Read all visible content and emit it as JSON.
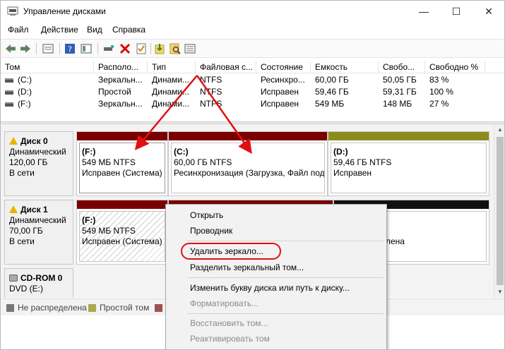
{
  "window": {
    "title": "Управление дисками",
    "minimize_glyph": "—",
    "maximize_glyph": "☐",
    "close_glyph": "✕"
  },
  "menu": [
    "Файл",
    "Действие",
    "Вид",
    "Справка"
  ],
  "toolbar": {
    "icons": [
      "back-icon",
      "forward-icon",
      "properties-icon",
      "help-icon",
      "show-hide-icon",
      "connect-icon",
      "delete-icon",
      "checklist-icon",
      "import-icon",
      "search-icon",
      "list-icon"
    ]
  },
  "volume_table": {
    "columns": [
      "Том",
      "Располо...",
      "Тип",
      "Файловая с...",
      "Состояние",
      "Емкость",
      "Свобо...",
      "Свободно %"
    ],
    "rows": [
      [
        "(C:)",
        "Зеркальн...",
        "Динами...",
        "NTFS",
        "Ресинхро...",
        "60,00 ГБ",
        "50,05 ГБ",
        "83 %"
      ],
      [
        "(D:)",
        "Простой",
        "Динами...",
        "NTFS",
        "Исправен",
        "59,46 ГБ",
        "59,31 ГБ",
        "100 %"
      ],
      [
        "(F:)",
        "Зеркальн...",
        "Динами...",
        "NTFS",
        "Исправен",
        "549 МБ",
        "148 МБ",
        "27 %"
      ]
    ]
  },
  "disks": [
    {
      "name": "Диск 0",
      "type": "Динамический",
      "size": "120,00 ГБ",
      "status": "В сети",
      "partitions": [
        {
          "letter": "(F:)",
          "size": "549 МБ NTFS",
          "state": "Исправен (Система)"
        },
        {
          "letter": "(C:)",
          "size": "60,00 ГБ NTFS",
          "state": "Ресинхронизация (Загрузка, Файл под"
        },
        {
          "letter": "(D:)",
          "size": "59,46 ГБ NTFS",
          "state": "Исправен"
        }
      ]
    },
    {
      "name": "Диск 1",
      "type": "Динамический",
      "size": "70,00 ГБ",
      "status": "В сети",
      "partitions": [
        {
          "letter": "(F:)",
          "size": "549 МБ NTFS",
          "state": "Исправен (Система)"
        },
        {
          "letter": "",
          "size": "",
          "state": ""
        },
        {
          "letter": "",
          "size": "",
          "state": "лена"
        }
      ]
    },
    {
      "name": "CD-ROM 0",
      "type": "DVD (E:)",
      "size": "",
      "status": ""
    }
  ],
  "legend": [
    {
      "label": "Не распределена",
      "color": "#777777"
    },
    {
      "label": "Простой том",
      "color": "#a9a94f"
    },
    {
      "label": "",
      "color": "#a05050"
    }
  ],
  "colors": {
    "mirror_bar": "#7a0000",
    "simple_bar": "#8c8c1e",
    "unallocated_bar": "#111111",
    "annotation_red": "#e01010"
  },
  "context_menu": {
    "items": [
      {
        "label": "Открыть",
        "enabled": true
      },
      {
        "label": "Проводник",
        "enabled": true
      },
      {
        "label": "Удалить зеркало...",
        "enabled": true,
        "highlighted": true
      },
      {
        "label": "Разделить зеркальный том...",
        "enabled": true
      },
      {
        "label": "Изменить букву диска или путь к диску...",
        "enabled": true
      },
      {
        "label": "Форматировать...",
        "enabled": false
      },
      {
        "label": "Восстановить том...",
        "enabled": false
      },
      {
        "label": "Реактивировать том",
        "enabled": false
      }
    ]
  }
}
